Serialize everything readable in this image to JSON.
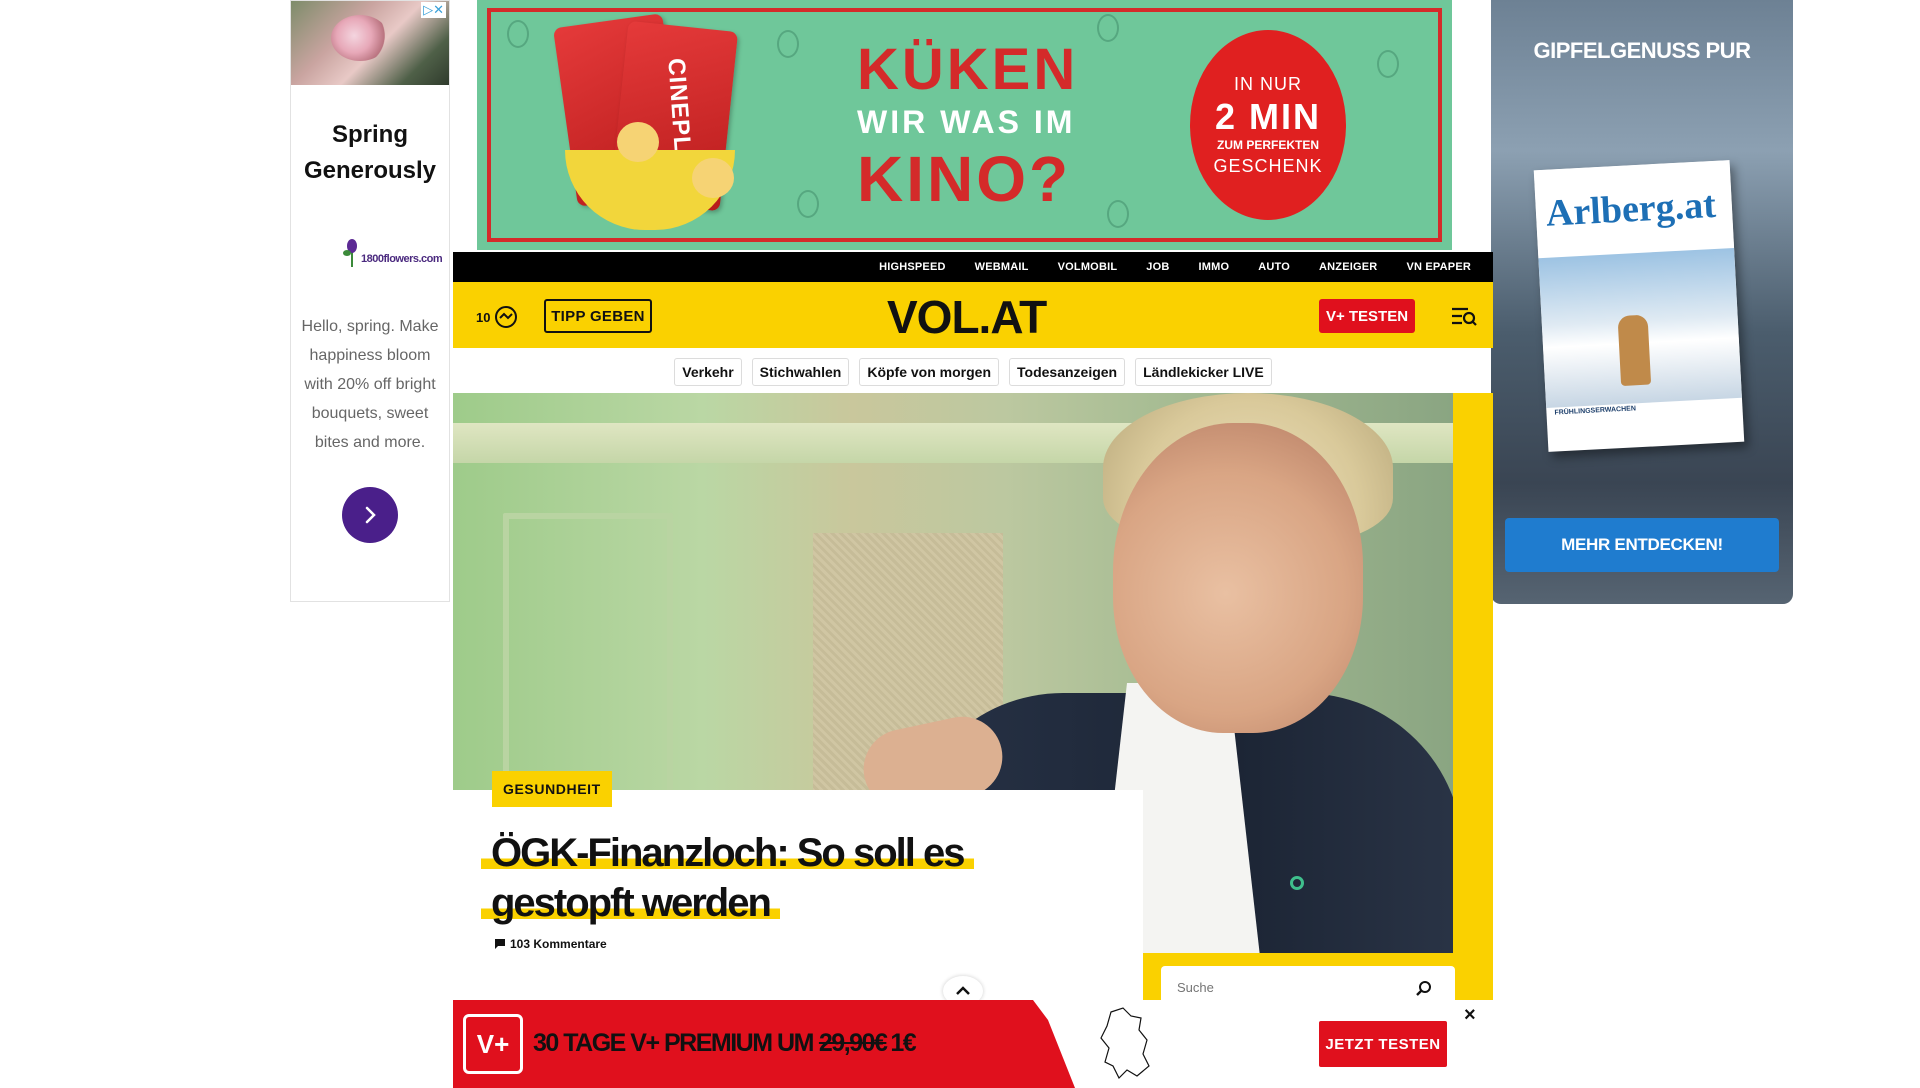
{
  "left_ad": {
    "adchoices_icon": "adchoices-close-icon",
    "title": "Spring Generously",
    "brand": "1800flowers.com",
    "body": "Hello, spring. Make happiness bloom with 20% off bright bouquets, sweet bites and more.",
    "cta_icon": "chevron-right-icon"
  },
  "top_ad": {
    "card_text": "CINEPLEXX",
    "headline1": "KÜKEN",
    "headline2": "WIR WAS IM",
    "headline3": "KINO?",
    "badge_line1": "IN NUR",
    "badge_line2": "2 MIN",
    "badge_line3": "ZUM PERFEKTEN",
    "badge_line4": "GESCHENK",
    "colors": {
      "background": "#6fc79a",
      "accent": "#d42a2a"
    }
  },
  "right_ad": {
    "title": "GIPFELGENUSS PUR",
    "magazine_name": "Arlberg.at",
    "magazine_footer": "FRÜHLINGSERWACHEN",
    "button": "MEHR ENTDECKEN!"
  },
  "topnav": {
    "items": [
      "HIGHSPEED",
      "WEBMAIL",
      "VOLMOBIL",
      "JOB",
      "IMMO",
      "AUTO",
      "ANZEIGER",
      "VN EPAPER"
    ]
  },
  "header": {
    "temperature": "10",
    "weather_icon": "weather-cloudy-icon",
    "tip_button": "TIPP GEBEN",
    "logo": "VOL.AT",
    "trial_button": "V+ TESTEN",
    "menu_icon": "menu-search-icon",
    "brand_color": "#fad100"
  },
  "topics": [
    "Verkehr",
    "Stichwahlen",
    "Köpfe von morgen",
    "Todesanzeigen",
    "Ländlekicker LIVE"
  ],
  "article": {
    "category": "GESUNDHEIT",
    "title": "ÖGK-Finanzloch: So soll es gestopft werden",
    "comments": "103 Kommentare"
  },
  "search": {
    "placeholder": "Suche"
  },
  "promo": {
    "logo": "V+",
    "text": "30 TAGE V+ PREMIUM UM",
    "old_price": "29,90€",
    "new_price": "1€",
    "button": "JETZT TESTEN",
    "close": "×",
    "colors": {
      "red": "#e0101d"
    }
  }
}
